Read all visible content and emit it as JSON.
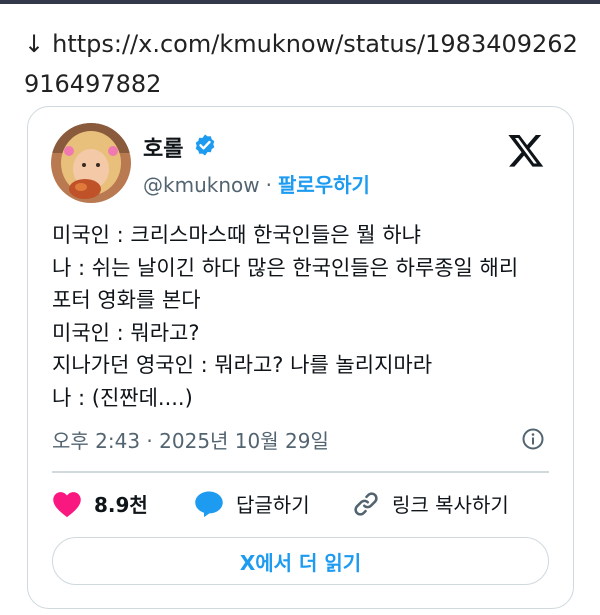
{
  "link": {
    "arrow": "↓",
    "url": "https://x.com/kmuknow/status/1983409262916497882"
  },
  "tweet": {
    "user_name": "호롤",
    "handle": "@kmuknow",
    "separator": "·",
    "follow_label": "팔로우하기",
    "lines": [
      "미국인 : 크리스마스때 한국인들은 뭘 하냐",
      "나 : 쉬는 날이긴 하다 많은 한국인들은 하루종일 해리",
      "포터 영화를 본다",
      "미국인 : 뭐라고?",
      "지나가던 영국인 : 뭐라고? 나를 놀리지마라",
      "나 : (진짠데....)"
    ],
    "timestamp": "오후 2:43 · 2025년 10월 29일",
    "like_count": "8.9천",
    "reply_label": "답글하기",
    "copy_link_label": "링크 복사하기",
    "read_more_label": "X에서 더 읽기"
  },
  "icons": {
    "verified": "verified-badge-icon",
    "x_logo": "x-logo-icon",
    "info": "info-icon",
    "heart": "heart-icon",
    "reply": "reply-bubble-icon",
    "link": "link-icon"
  },
  "colors": {
    "accent": "#1d9bf0",
    "heart": "#f91880",
    "secondary_text": "#536471",
    "border": "#cfd9de"
  }
}
